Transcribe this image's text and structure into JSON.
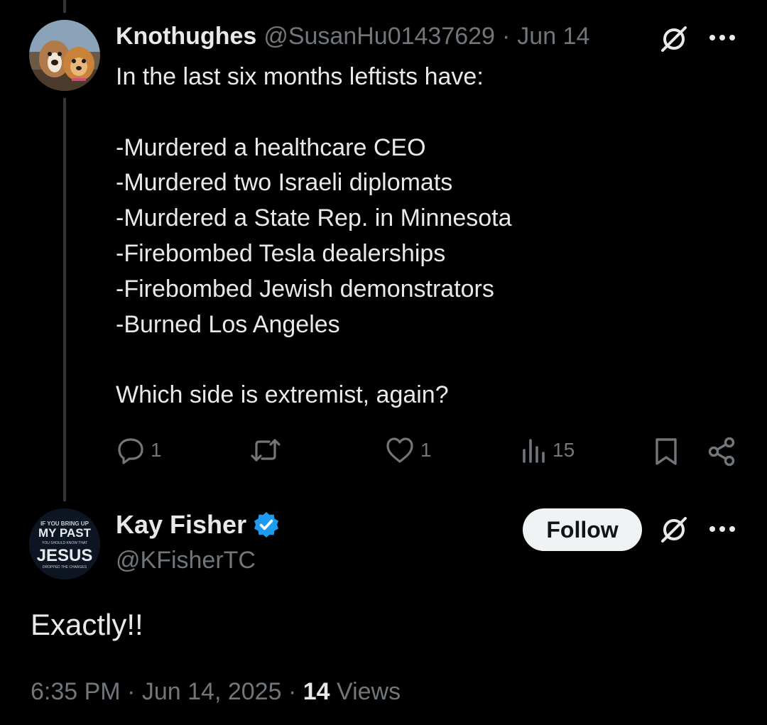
{
  "colors": {
    "background": "#000000",
    "text": "#e7e9ea",
    "muted": "#71767b",
    "verified": "#1d9bf0",
    "follow_bg": "#eff3f4"
  },
  "parent_post": {
    "display_name": "Knothughes",
    "handle": "@SusanHu01437629",
    "separator": "·",
    "date": "Jun 14",
    "text": "In the last six months leftists have:\n\n-Murdered a healthcare CEO\n-Murdered two Israeli diplomats\n-Murdered a State Rep. in Minnesota\n-Firebombed Tesla dealerships\n-Firebombed Jewish demonstrators\n-Burned Los Angeles\n\nWhich side is extremist, again?",
    "actions": {
      "replies": "1",
      "reposts": "",
      "likes": "1",
      "views": "15"
    },
    "icons": [
      "avatar-dogs",
      "grok-icon",
      "more-icon",
      "reply-icon",
      "repost-icon",
      "like-icon",
      "views-icon",
      "bookmark-icon",
      "share-icon"
    ]
  },
  "reply_post": {
    "display_name": "Kay Fisher",
    "handle": "@KFisherTC",
    "verified": true,
    "follow_label": "Follow",
    "avatar_text": {
      "line1": "IF YOU BRING UP",
      "line2": "MY PAST",
      "line3": "YOU SHOULD KNOW THAT",
      "line4": "JESUS",
      "line5": "DROPPED THE CHARGES"
    },
    "text": "Exactly!!",
    "time": "6:35 PM",
    "separator": "·",
    "date": "Jun 14, 2025",
    "views_count": "14",
    "views_label": "Views"
  }
}
